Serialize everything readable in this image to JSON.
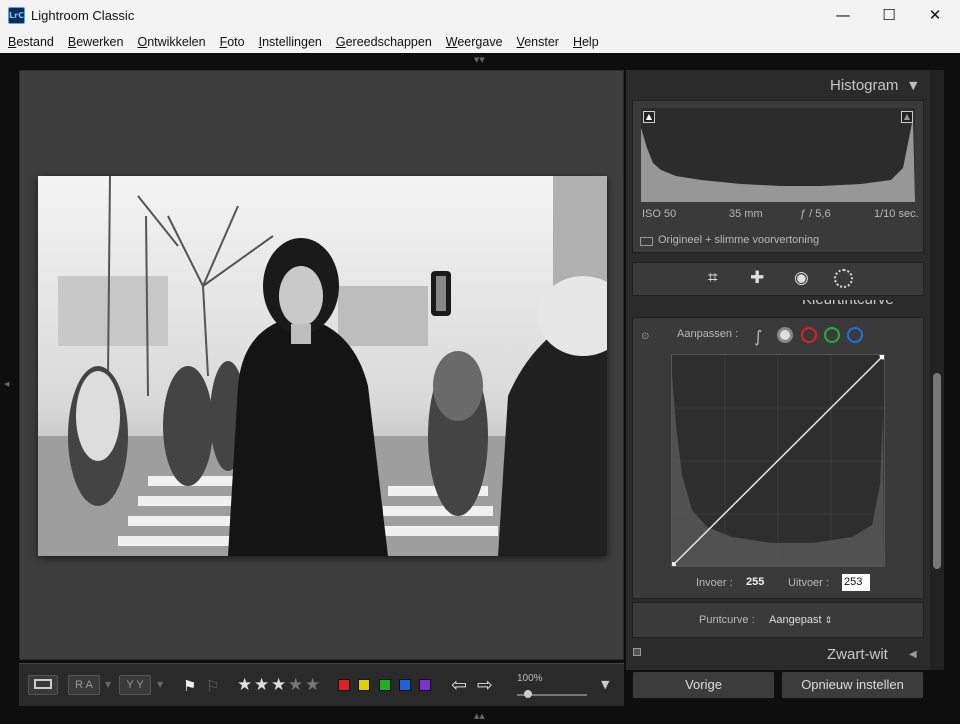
{
  "window": {
    "app_icon_text": "LrC",
    "title": "Lightroom Classic",
    "minimize": "—",
    "maximize": "☐",
    "close": "✕"
  },
  "menu": [
    {
      "label": "Bestand"
    },
    {
      "label": "Bewerken"
    },
    {
      "label": "Ontwikkelen"
    },
    {
      "label": "Foto"
    },
    {
      "label": "Instellingen"
    },
    {
      "label": "Gereedschappen"
    },
    {
      "label": "Weergave"
    },
    {
      "label": "Venster"
    },
    {
      "label": "Help"
    }
  ],
  "histogram": {
    "title": "Histogram",
    "iso": "ISO 50",
    "focal": "35 mm",
    "aperture": "ƒ / 5,6",
    "shutter": "1/10 sec.",
    "preview_label": "Origineel + slimme voorvertoning"
  },
  "tone_curve": {
    "title": "Kleurtintcurve",
    "adjust_label": "Aanpassen :",
    "input_label": "Invoer :",
    "input_value": "255",
    "output_label": "Uitvoer :",
    "output_value": "253",
    "point_curve_label": "Puntcurve :",
    "point_curve_value": "Aangepast"
  },
  "bw_panel": {
    "title": "Zwart-wit"
  },
  "buttons": {
    "previous": "Vorige",
    "reset": "Opnieuw instellen"
  },
  "toolbar": {
    "view_ra": "R A",
    "view_yy": "Y Y",
    "zoom": "100%",
    "rating": 3,
    "colors": [
      "#e02020",
      "#e0d000",
      "#20b020",
      "#2060e0",
      "#8030d0"
    ]
  },
  "colors": {
    "accent": "#0b2c55"
  }
}
